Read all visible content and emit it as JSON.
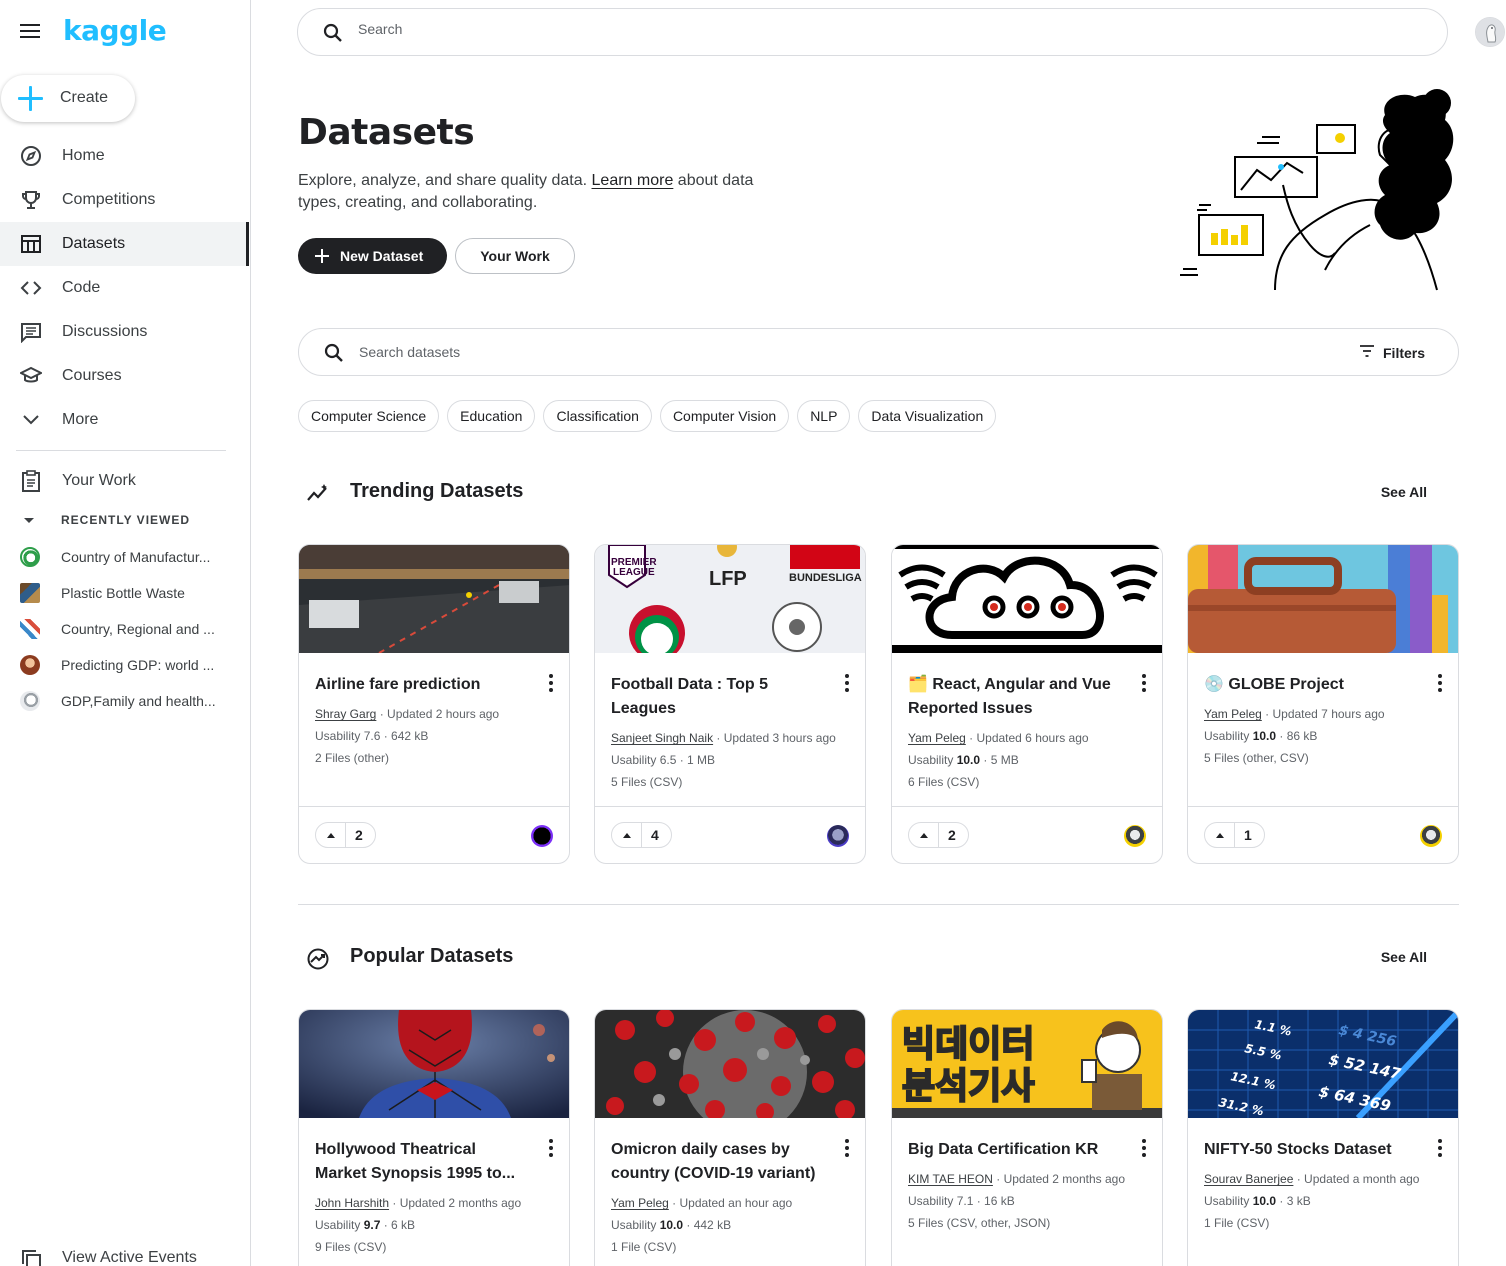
{
  "sidebar": {
    "logo": "kaggle",
    "create_label": "Create",
    "nav": [
      {
        "label": "Home",
        "icon": "compass-icon"
      },
      {
        "label": "Competitions",
        "icon": "trophy-icon"
      },
      {
        "label": "Datasets",
        "icon": "table-icon",
        "active": true
      },
      {
        "label": "Code",
        "icon": "code-icon"
      },
      {
        "label": "Discussions",
        "icon": "comment-icon"
      },
      {
        "label": "Courses",
        "icon": "school-icon"
      },
      {
        "label": "More",
        "icon": "chevron-down-icon"
      }
    ],
    "your_work": "Your Work",
    "recently_viewed_label": "RECENTLY VIEWED",
    "recent": [
      "Country of Manufactur...",
      "Plastic Bottle Waste",
      "Country, Regional and ...",
      "Predicting GDP: world ...",
      "GDP,Family and health..."
    ],
    "view_events": "View Active Events"
  },
  "top_search": {
    "placeholder": "Search"
  },
  "hero": {
    "title": "Datasets",
    "desc_before": "Explore, analyze, and share quality data. ",
    "learn_more": "Learn more",
    "desc_after": " about data types, creating, and collaborating.",
    "new_dataset": "New Dataset",
    "your_work": "Your Work"
  },
  "dataset_search": {
    "placeholder": "Search datasets",
    "filters": "Filters"
  },
  "chips": [
    "Computer Science",
    "Education",
    "Classification",
    "Computer Vision",
    "NLP",
    "Data Visualization"
  ],
  "trending": {
    "title": "Trending Datasets",
    "see_all": "See All",
    "cards": [
      {
        "title": "Airline fare prediction",
        "author": "Shray Garg",
        "updated": " · Updated 2 hours ago",
        "usability_label": "Usability ",
        "usability": "7.6",
        "size": " · 642 kB",
        "files": "2 Files (other)",
        "votes": "2"
      },
      {
        "title": "Football Data : Top 5 Leagues",
        "author": "Sanjeet Singh Naik",
        "updated": " · Updated 3 hours ago",
        "usability_label": "Usability ",
        "usability": "6.5",
        "size": " · 1 MB",
        "files": "5 Files (CSV)",
        "votes": "4"
      },
      {
        "title": "🗂️ React, Angular and Vue Reported Issues",
        "author": "Yam Peleg",
        "updated": " · Updated 6 hours ago",
        "usability_label": "Usability ",
        "usability": "10.0",
        "size": " · 5 MB",
        "files": "6 Files (CSV)",
        "votes": "2"
      },
      {
        "title": "💿 GLOBE Project",
        "author": "Yam Peleg",
        "updated": " · Updated 7 hours ago",
        "usability_label": "Usability ",
        "usability": "10.0",
        "size": " · 86 kB",
        "files": "5 Files (other, CSV)",
        "votes": "1"
      }
    ]
  },
  "popular": {
    "title": "Popular Datasets",
    "see_all": "See All",
    "cards": [
      {
        "title": "Hollywood Theatrical Market Synopsis 1995 to...",
        "author": "John Harshith",
        "updated": " · Updated 2 months ago",
        "usability_label": "Usability ",
        "usability": "9.7",
        "size": " · 6 kB",
        "files": "9 Files (CSV)"
      },
      {
        "title": "Omicron daily cases by country (COVID-19 variant)",
        "author": "Yam Peleg",
        "updated": " · Updated an hour ago",
        "usability_label": "Usability ",
        "usability": "10.0",
        "size": " · 442 kB",
        "files": "1 File (CSV)"
      },
      {
        "title": "Big Data Certification KR",
        "author": "KIM TAE HEON",
        "updated": " · Updated 2 months ago",
        "usability_label": "Usability ",
        "usability": "7.1",
        "size": " · 16 kB",
        "files": "5 Files (CSV, other, JSON)"
      },
      {
        "title": "NIFTY-50 Stocks Dataset",
        "author": "Sourav Banerjee",
        "updated": " · Updated a month ago",
        "usability_label": "Usability ",
        "usability": "10.0",
        "size": " · 3 kB",
        "files": "1 File (CSV)"
      }
    ]
  },
  "card_images": {
    "football_labels": [
      "PREMIER",
      "LEAGUE",
      "LFP",
      "BUNDESLIGA"
    ],
    "bigdata_lines": [
      "빅데이터",
      "분석기사"
    ],
    "nifty_values": [
      "1.1 %",
      "5.5 %",
      "12.1 %",
      "31.2 %",
      "$ 4 256",
      "$ 52 147",
      "$ 64 369"
    ]
  },
  "colors": {
    "brand": "#20beff",
    "active_nav": "#202124",
    "border": "#dadce0"
  }
}
